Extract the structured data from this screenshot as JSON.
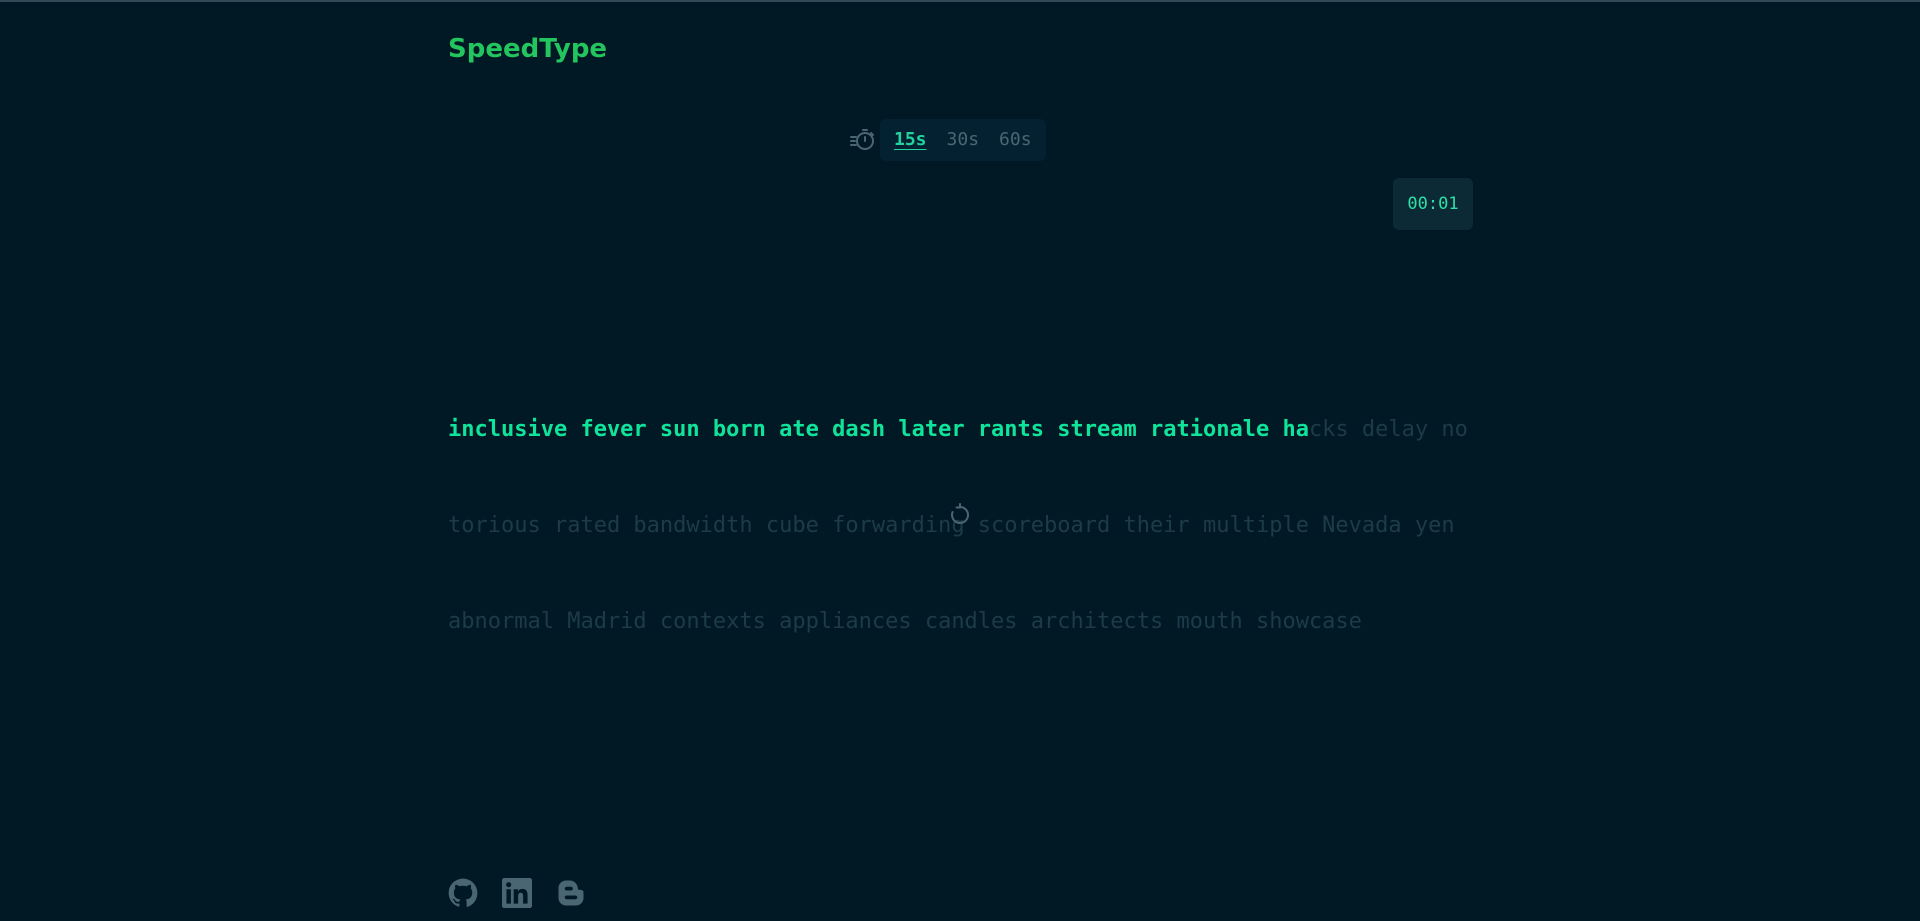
{
  "app": {
    "name": "SpeedType"
  },
  "time_selector": {
    "icon": "timer-icon",
    "options": [
      "15s",
      "30s",
      "60s"
    ],
    "selected": "15s"
  },
  "timer": {
    "display": "00:01"
  },
  "text": {
    "lines": [
      {
        "typed": "inclusive fever sun born ate dash later rants stream rationale ha",
        "untyped": "cks delay no"
      },
      {
        "typed": "",
        "untyped": "torious rated bandwidth cube forwarding scoreboard their multiple Nevada yen"
      },
      {
        "typed": "",
        "untyped": "abnormal Madrid contexts appliances candles architects mouth showcase"
      }
    ]
  },
  "controls": {
    "restart_icon": "restart-icon"
  },
  "footer": {
    "links": [
      "github-icon",
      "linkedin-icon",
      "blogger-icon"
    ]
  },
  "colors": {
    "background": "#011925",
    "accent": "#22c55e",
    "typed": "#10e39a",
    "untyped": "#1d3b48",
    "muted": "#4a6672"
  }
}
